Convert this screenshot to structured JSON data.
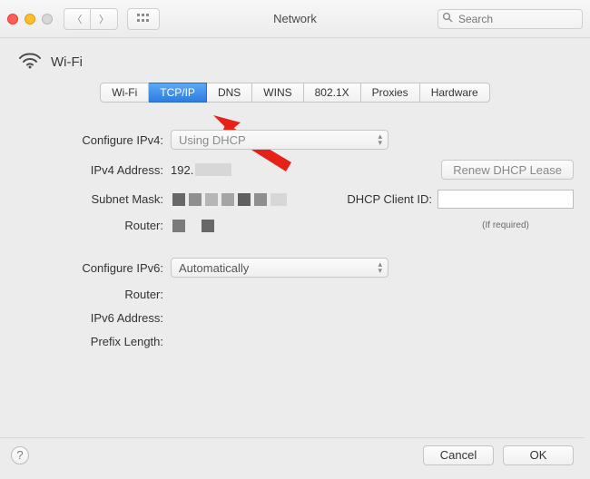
{
  "toolbar": {
    "title": "Network",
    "search_placeholder": "Search"
  },
  "header": {
    "title": "Wi-Fi"
  },
  "tabs": {
    "items": [
      {
        "label": "Wi-Fi",
        "selected": false
      },
      {
        "label": "TCP/IP",
        "selected": true
      },
      {
        "label": "DNS",
        "selected": false
      },
      {
        "label": "WINS",
        "selected": false
      },
      {
        "label": "802.1X",
        "selected": false
      },
      {
        "label": "Proxies",
        "selected": false
      },
      {
        "label": "Hardware",
        "selected": false
      }
    ]
  },
  "form": {
    "configure_ipv4_label": "Configure IPv4:",
    "configure_ipv4_value": "Using DHCP",
    "ipv4_address_label": "IPv4 Address:",
    "ipv4_address_value": "192.",
    "subnet_mask_label": "Subnet Mask:",
    "router_label": "Router:",
    "renew_button": "Renew DHCP Lease",
    "dhcp_client_id_label": "DHCP Client ID:",
    "dhcp_client_id_value": "",
    "if_required": "(If required)",
    "configure_ipv6_label": "Configure IPv6:",
    "configure_ipv6_value": "Automatically",
    "router6_label": "Router:",
    "ipv6_address_label": "IPv6 Address:",
    "prefix_length_label": "Prefix Length:"
  },
  "footer": {
    "cancel": "Cancel",
    "ok": "OK"
  }
}
